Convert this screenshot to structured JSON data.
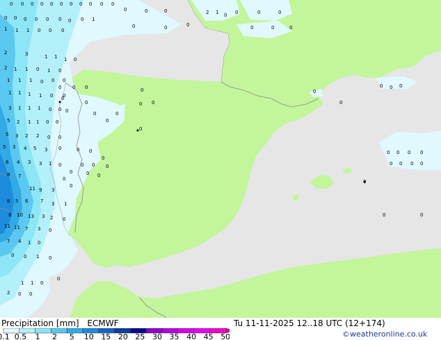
{
  "header": {
    "title": "Precipitation [mm]",
    "model": "ECMWF",
    "valid_time": "Tu 11-11-2025 12..18 UTC (12+174)",
    "credit": "©weatheronline.co.uk"
  },
  "legend": {
    "levels": [
      "0.1",
      "0.5",
      "1",
      "2",
      "5",
      "10",
      "15",
      "20",
      "25",
      "30",
      "35",
      "40",
      "45",
      "50"
    ],
    "colors": [
      "#e0f8ff",
      "#b4f0fa",
      "#8ce6f5",
      "#5ac8f0",
      "#32aae6",
      "#1e8cdc",
      "#1464c8",
      "#0a3ca5",
      "#000a8c",
      "#8c00c8",
      "#b400dc",
      "#d200e6",
      "#e600f0",
      "#f000c8",
      "#d20096"
    ]
  },
  "colors": {
    "sea": "#e6e6e6",
    "land": "#c3f59b",
    "border": "#8a8a8a"
  },
  "cell_values": [
    "0",
    "0",
    "0",
    "0",
    "0",
    "0",
    "0",
    "0",
    "0",
    "0",
    "0",
    "0",
    "0",
    "0",
    "2",
    "1",
    "0",
    "0",
    "0",
    "0",
    "0",
    "0",
    "0",
    "0",
    "0",
    "0",
    "0",
    "0",
    "1",
    "0",
    "0",
    "0",
    "1",
    "1",
    "1",
    "0",
    "0",
    "0",
    "2",
    "3",
    "1",
    "1",
    "1",
    "0",
    "2",
    "1",
    "1",
    "0",
    "1",
    "0",
    "1",
    "1",
    "1",
    "0",
    "0",
    "0",
    "1",
    "1",
    "1",
    "1",
    "0",
    "0",
    "3",
    "1",
    "1",
    "1",
    "0",
    "0",
    "0",
    "5",
    "2",
    "1",
    "1",
    "0",
    "0",
    "5",
    "3",
    "2",
    "2",
    "0",
    "0",
    "5",
    "3",
    "4",
    "5",
    "3",
    "0",
    "6",
    "4",
    "3",
    "3",
    "1",
    "0",
    "8",
    "7",
    "11",
    "9",
    "3",
    "0",
    "8",
    "5",
    "6",
    "7",
    "3",
    "1",
    "8",
    "10",
    "13",
    "3",
    "2",
    "0",
    "11",
    "11",
    "7",
    "3",
    "0",
    "7",
    "4",
    "1",
    "0",
    "0",
    "0",
    "1",
    "0",
    "1",
    "1",
    "0",
    "0",
    "2",
    "0",
    "0",
    "0",
    "0",
    "0",
    "0",
    "0",
    "0",
    "0",
    "0",
    "0",
    "0",
    "0",
    "0",
    "0",
    "0",
    "0",
    "0",
    "0",
    "0",
    "0",
    "0",
    "0",
    "0",
    "0",
    "0",
    "0",
    "0",
    "0",
    "0",
    "0",
    "0",
    "0",
    "0",
    "0",
    "0",
    "0",
    "0",
    "0",
    "0",
    "0",
    "0",
    "0"
  ]
}
